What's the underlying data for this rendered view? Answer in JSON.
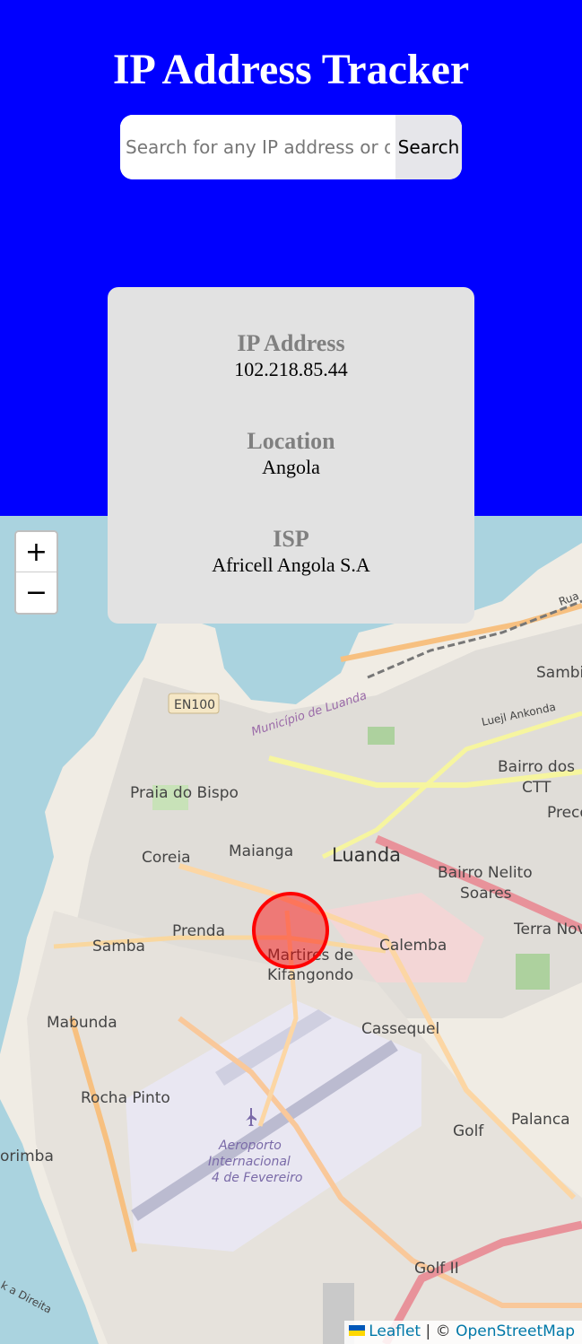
{
  "header": {
    "title": "IP Address Tracker"
  },
  "search": {
    "placeholder": "Search for any IP address or domain",
    "button_label": "Search"
  },
  "info": {
    "ip_label": "IP Address",
    "ip_value": "102.218.85.44",
    "location_label": "Location",
    "location_value": "Angola",
    "isp_label": "ISP",
    "isp_value": "Africell Angola S.A"
  },
  "map": {
    "zoom_in": "+",
    "zoom_out": "−",
    "places": [
      {
        "id": "sambi",
        "label": "Sambi"
      },
      {
        "id": "bairro-dos",
        "label": "Bairro dos"
      },
      {
        "id": "ctt",
        "label": "CTT"
      },
      {
        "id": "preco",
        "label": "Preco"
      },
      {
        "id": "praia-do-bispo",
        "label": "Praia do Bispo"
      },
      {
        "id": "coreia",
        "label": "Coreia"
      },
      {
        "id": "maianga",
        "label": "Maianga"
      },
      {
        "id": "luanda",
        "label": "Luanda"
      },
      {
        "id": "bairro-nelito",
        "label": "Bairro Nelito"
      },
      {
        "id": "soares",
        "label": "Soares"
      },
      {
        "id": "terra-nov",
        "label": "Terra Nov"
      },
      {
        "id": "prenda",
        "label": "Prenda"
      },
      {
        "id": "samba",
        "label": "Samba"
      },
      {
        "id": "martires",
        "label": "Martires de"
      },
      {
        "id": "kifangondo",
        "label": "Kifangondo"
      },
      {
        "id": "calemba",
        "label": "Calemba"
      },
      {
        "id": "mabunda",
        "label": "Mabunda"
      },
      {
        "id": "cassequel",
        "label": "Cassequel"
      },
      {
        "id": "rocha-pinto",
        "label": "Rocha Pinto"
      },
      {
        "id": "golf",
        "label": "Golf"
      },
      {
        "id": "palanca",
        "label": "Palanca"
      },
      {
        "id": "orimba",
        "label": "orimba"
      },
      {
        "id": "golf-ii",
        "label": "Golf II"
      },
      {
        "id": "aeroporto",
        "label": "Aeroporto"
      },
      {
        "id": "internacional",
        "label": "Internacional"
      },
      {
        "id": "fevereiro",
        "label": "4 de Fevereiro"
      },
      {
        "id": "en100",
        "label": "EN100"
      },
      {
        "id": "municipio",
        "label": "Município de Luanda"
      },
      {
        "id": "luejl",
        "label": "Luejl Ankonda"
      },
      {
        "id": "direita",
        "label": "k a Direita"
      },
      {
        "id": "rua",
        "label": "Rua"
      }
    ]
  },
  "attribution": {
    "leaflet": "Leaflet",
    "separator": "| ©",
    "osm": "OpenStreetMap"
  },
  "colors": {
    "header_bg": "#0000ff",
    "card_bg": "#e2e2e2",
    "marker": "#ff0000",
    "water": "#aad3df"
  }
}
